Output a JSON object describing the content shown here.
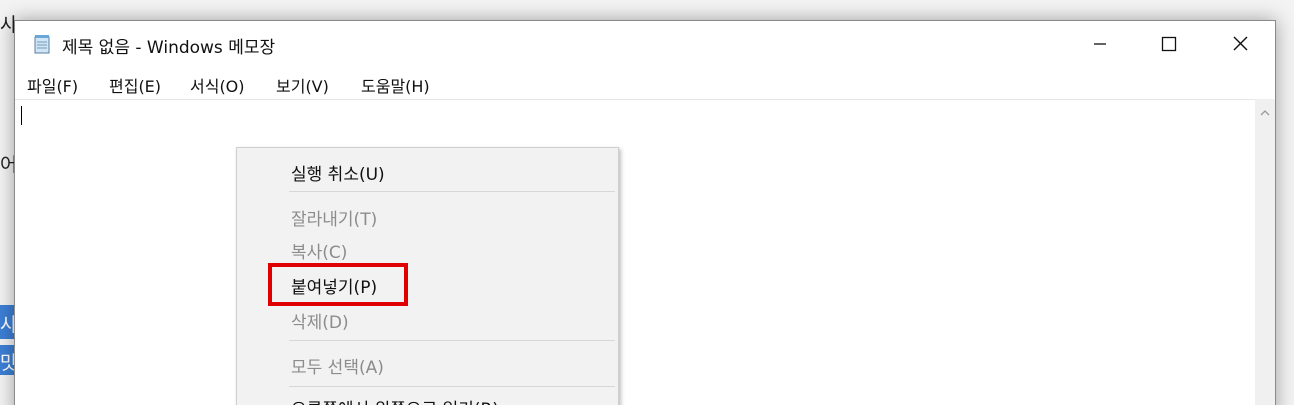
{
  "background": {
    "fragments": [
      "사",
      "어",
      "사",
      "맛"
    ]
  },
  "window": {
    "title": "제목 없음 - Windows 메모장",
    "icon": "notepad-icon",
    "controls": {
      "minimize_icon": "minimize-icon",
      "maximize_icon": "maximize-icon",
      "close_icon": "close-icon"
    }
  },
  "menubar": {
    "items": [
      "파일(F)",
      "편집(E)",
      "서식(O)",
      "보기(V)",
      "도움말(H)"
    ]
  },
  "editor": {
    "content": ""
  },
  "context_menu": {
    "items": [
      {
        "label": "실행 취소(U)",
        "enabled": true
      },
      {
        "label": "잘라내기(T)",
        "enabled": false
      },
      {
        "label": "복사(C)",
        "enabled": false
      },
      {
        "label": "붙여넣기(P)",
        "enabled": true
      },
      {
        "label": "삭제(D)",
        "enabled": false
      },
      {
        "label": "모두 선택(A)",
        "enabled": false
      },
      {
        "label": "오른쪽에서 왼쪽으로 읽기(R)",
        "enabled": true
      }
    ]
  },
  "colors": {
    "highlight": "#e00000",
    "selection": "#3d7fd6"
  }
}
